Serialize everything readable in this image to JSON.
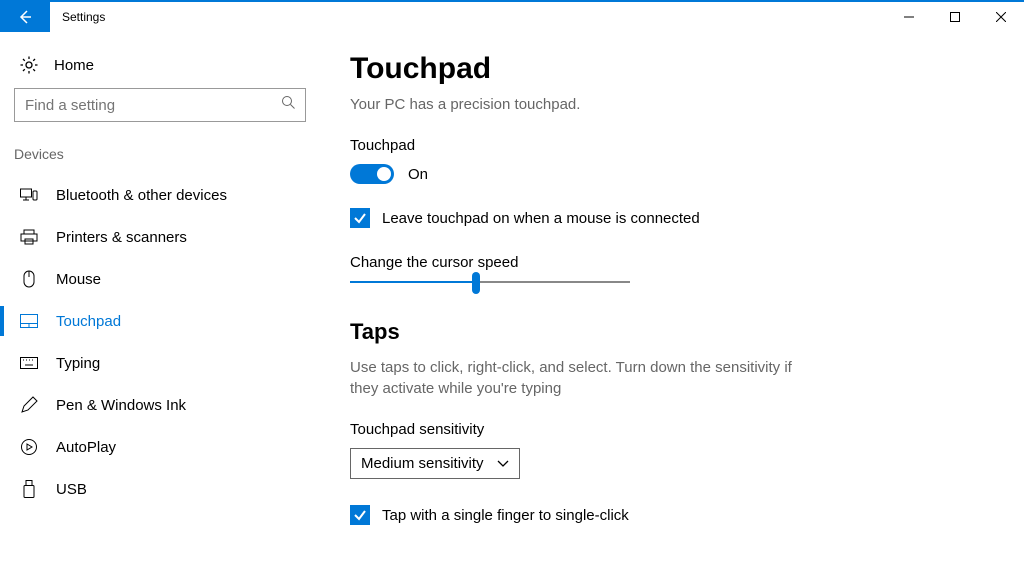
{
  "window": {
    "title": "Settings"
  },
  "sidebar": {
    "home": "Home",
    "search_placeholder": "Find a setting",
    "group": "Devices",
    "items": [
      {
        "label": "Bluetooth & other devices"
      },
      {
        "label": "Printers & scanners"
      },
      {
        "label": "Mouse"
      },
      {
        "label": "Touchpad"
      },
      {
        "label": "Typing"
      },
      {
        "label": "Pen & Windows Ink"
      },
      {
        "label": "AutoPlay"
      },
      {
        "label": "USB"
      }
    ]
  },
  "main": {
    "heading": "Touchpad",
    "subheading": "Your PC has a precision touchpad.",
    "toggle_label": "Touchpad",
    "toggle_state": "On",
    "leave_on_label": "Leave touchpad on when a mouse is connected",
    "cursor_speed_label": "Change the cursor speed",
    "taps_heading": "Taps",
    "taps_desc": "Use taps to click, right-click, and select. Turn down the sensitivity if they activate while you're typing",
    "sensitivity_label": "Touchpad sensitivity",
    "sensitivity_value": "Medium sensitivity",
    "single_tap_label": "Tap with a single finger to single-click"
  }
}
